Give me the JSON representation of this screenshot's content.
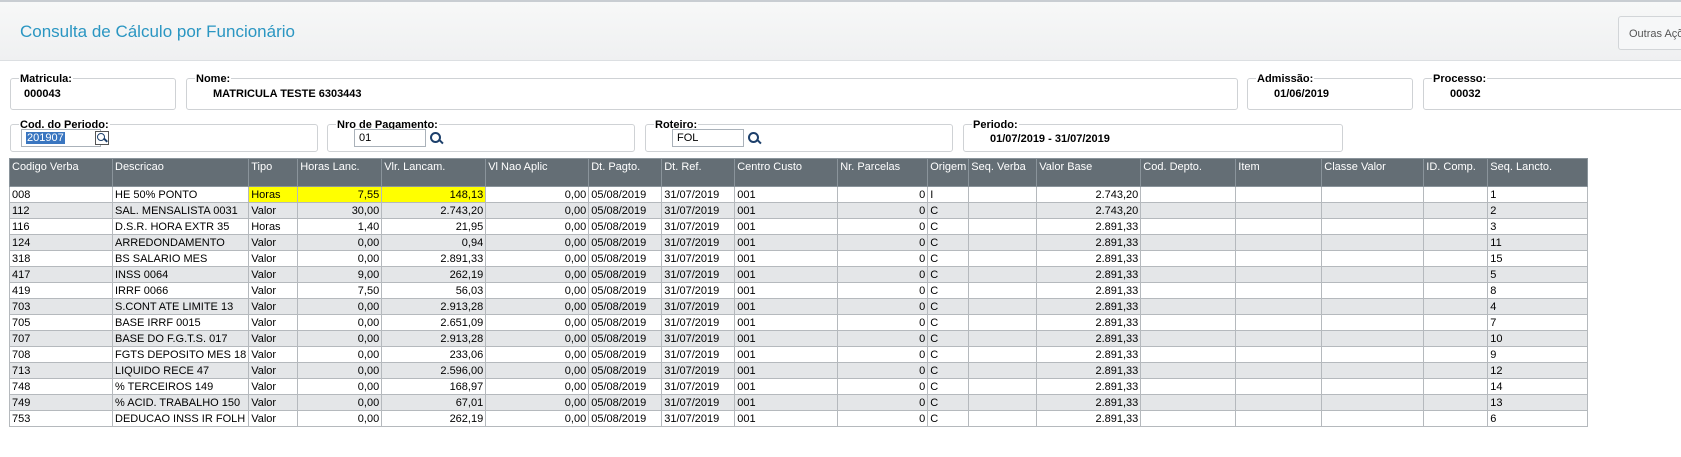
{
  "page": {
    "title": "Consulta de Cálculo por Funcionário",
    "actions_button": "Outras Açõ"
  },
  "fields": {
    "matricula": {
      "label": "Matricula:",
      "value": "000043"
    },
    "nome": {
      "label": "Nome:",
      "value": "MATRICULA TESTE 6303443"
    },
    "admissao": {
      "label": "Admissão:",
      "value": "01/06/2019"
    },
    "processo": {
      "label": "Processo:",
      "value": "00032"
    },
    "cod_periodo": {
      "label": "Cod. do Periodo:",
      "value": "201907"
    },
    "nro_pagamento": {
      "label": "Nro de Pagamento:",
      "value": "01"
    },
    "roteiro": {
      "label": "Roteiro:",
      "value": "FOL"
    },
    "periodo": {
      "label": "Periodo:",
      "value": "01/07/2019 - 31/07/2019"
    }
  },
  "table": {
    "columns": [
      "Codigo Verba",
      "Descricao",
      "Tipo",
      "Horas Lanc.",
      "Vlr. Lancam.",
      "Vl Nao Aplic",
      "Dt. Pagto.",
      "Dt. Ref.",
      "Centro Custo",
      "Nr. Parcelas",
      "Origem",
      "Seq. Verba",
      "Valor Base",
      "Cod. Depto.",
      "Item",
      "Classe Valor",
      "ID. Comp.",
      "Seq. Lancto."
    ],
    "rows": [
      [
        "008",
        "HE 50% PONTO",
        "Horas",
        "7,55",
        "148,13",
        "0,00",
        "05/08/2019",
        "31/07/2019",
        "001",
        "0",
        "I",
        "",
        "2.743,20",
        "",
        "",
        "",
        "",
        "1"
      ],
      [
        "112",
        "SAL. MENSALISTA 0031",
        "Valor",
        "30,00",
        "2.743,20",
        "0,00",
        "05/08/2019",
        "31/07/2019",
        "001",
        "0",
        "C",
        "",
        "2.743,20",
        "",
        "",
        "",
        "",
        "2"
      ],
      [
        "116",
        "D.S.R. HORA EXTR  35",
        "Horas",
        "1,40",
        "21,95",
        "0,00",
        "05/08/2019",
        "31/07/2019",
        "001",
        "0",
        "C",
        "",
        "2.891,33",
        "",
        "",
        "",
        "",
        "3"
      ],
      [
        "124",
        "ARREDONDAMENTO",
        "Valor",
        "0,00",
        "0,94",
        "0,00",
        "05/08/2019",
        "31/07/2019",
        "001",
        "0",
        "C",
        "",
        "2.891,33",
        "",
        "",
        "",
        "",
        "11"
      ],
      [
        "318",
        "BS SALARIO MES",
        "Valor",
        "0,00",
        "2.891,33",
        "0,00",
        "05/08/2019",
        "31/07/2019",
        "001",
        "0",
        "C",
        "",
        "2.891,33",
        "",
        "",
        "",
        "",
        "15"
      ],
      [
        "417",
        "INSS 0064",
        "Valor",
        "9,00",
        "262,19",
        "0,00",
        "05/08/2019",
        "31/07/2019",
        "001",
        "0",
        "C",
        "",
        "2.891,33",
        "",
        "",
        "",
        "",
        "5"
      ],
      [
        "419",
        "IRRF 0066",
        "Valor",
        "7,50",
        "56,03",
        "0,00",
        "05/08/2019",
        "31/07/2019",
        "001",
        "0",
        "C",
        "",
        "2.891,33",
        "",
        "",
        "",
        "",
        "8"
      ],
      [
        "703",
        "S.CONT ATE LIMITE 13",
        "Valor",
        "0,00",
        "2.913,28",
        "0,00",
        "05/08/2019",
        "31/07/2019",
        "001",
        "0",
        "C",
        "",
        "2.891,33",
        "",
        "",
        "",
        "",
        "4"
      ],
      [
        "705",
        "BASE IRRF 0015",
        "Valor",
        "0,00",
        "2.651,09",
        "0,00",
        "05/08/2019",
        "31/07/2019",
        "001",
        "0",
        "C",
        "",
        "2.891,33",
        "",
        "",
        "",
        "",
        "7"
      ],
      [
        "707",
        "BASE DO F.G.T.S. 017",
        "Valor",
        "0,00",
        "2.913,28",
        "0,00",
        "05/08/2019",
        "31/07/2019",
        "001",
        "0",
        "C",
        "",
        "2.891,33",
        "",
        "",
        "",
        "",
        "10"
      ],
      [
        "708",
        "FGTS DEPOSITO MES 18",
        "Valor",
        "0,00",
        "233,06",
        "0,00",
        "05/08/2019",
        "31/07/2019",
        "001",
        "0",
        "C",
        "",
        "2.891,33",
        "",
        "",
        "",
        "",
        "9"
      ],
      [
        "713",
        "LIQUIDO RECE 47",
        "Valor",
        "0,00",
        "2.596,00",
        "0,00",
        "05/08/2019",
        "31/07/2019",
        "001",
        "0",
        "C",
        "",
        "2.891,33",
        "",
        "",
        "",
        "",
        "12"
      ],
      [
        "748",
        "% TERCEIROS 149",
        "Valor",
        "0,00",
        "168,97",
        "0,00",
        "05/08/2019",
        "31/07/2019",
        "001",
        "0",
        "C",
        "",
        "2.891,33",
        "",
        "",
        "",
        "",
        "14"
      ],
      [
        "749",
        "% ACID. TRABALHO 150",
        "Valor",
        "0,00",
        "67,01",
        "0,00",
        "05/08/2019",
        "31/07/2019",
        "001",
        "0",
        "C",
        "",
        "2.891,33",
        "",
        "",
        "",
        "",
        "13"
      ],
      [
        "753",
        "DEDUCAO INSS IR FOLH",
        "Valor",
        "0,00",
        "262,19",
        "0,00",
        "05/08/2019",
        "31/07/2019",
        "001",
        "0",
        "C",
        "",
        "2.891,33",
        "",
        "",
        "",
        "",
        "6"
      ]
    ]
  },
  "colors": {
    "title": "#2a96c2",
    "header_bg": "#646e75",
    "highlight": "#ffff00"
  }
}
